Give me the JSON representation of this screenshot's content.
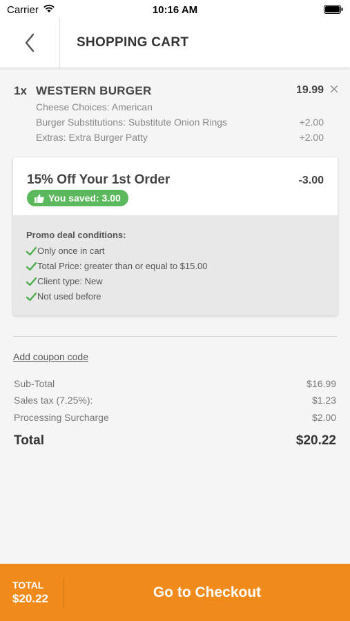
{
  "status_bar": {
    "carrier": "Carrier",
    "time": "10:16 AM"
  },
  "header": {
    "title": "SHOPPING CART"
  },
  "cart_item": {
    "quantity": "1x",
    "name": "WESTERN BURGER",
    "price": "19.99",
    "modifiers": [
      {
        "label": "Cheese Choices: American",
        "price": ""
      },
      {
        "label": "Burger Substitutions: Substitute Onion Rings",
        "price": "+2.00"
      },
      {
        "label": "Extras: Extra Burger Patty",
        "price": "+2.00"
      }
    ]
  },
  "promo": {
    "title": "15% Off Your 1st Order",
    "discount": "-3.00",
    "saved_label": "You saved: 3.00",
    "conditions_heading": "Promo deal conditions:",
    "conditions": [
      "Only once in cart",
      "Total Price: greater than or equal to $15.00",
      "Client type: New",
      "Not used before"
    ]
  },
  "coupon": {
    "link_label": "Add coupon code"
  },
  "summary": {
    "subtotal_label": "Sub-Total",
    "subtotal_value": "$16.99",
    "tax_label": "Sales tax (7.25%):",
    "tax_value": "$1.23",
    "surcharge_label": "Processing Surcharge",
    "surcharge_value": "$2.00",
    "total_label": "Total",
    "total_value": "$20.22"
  },
  "checkout_bar": {
    "total_label": "TOTAL",
    "total_value": "$20.22",
    "button_label": "Go to Checkout"
  },
  "colors": {
    "accent": "#ef8a1b",
    "success": "#5cb85c",
    "check": "#4cae4c"
  },
  "icons": [
    "wifi-icon",
    "battery-icon",
    "chevron-left-icon",
    "close-icon",
    "thumbs-up-icon",
    "check-icon"
  ]
}
